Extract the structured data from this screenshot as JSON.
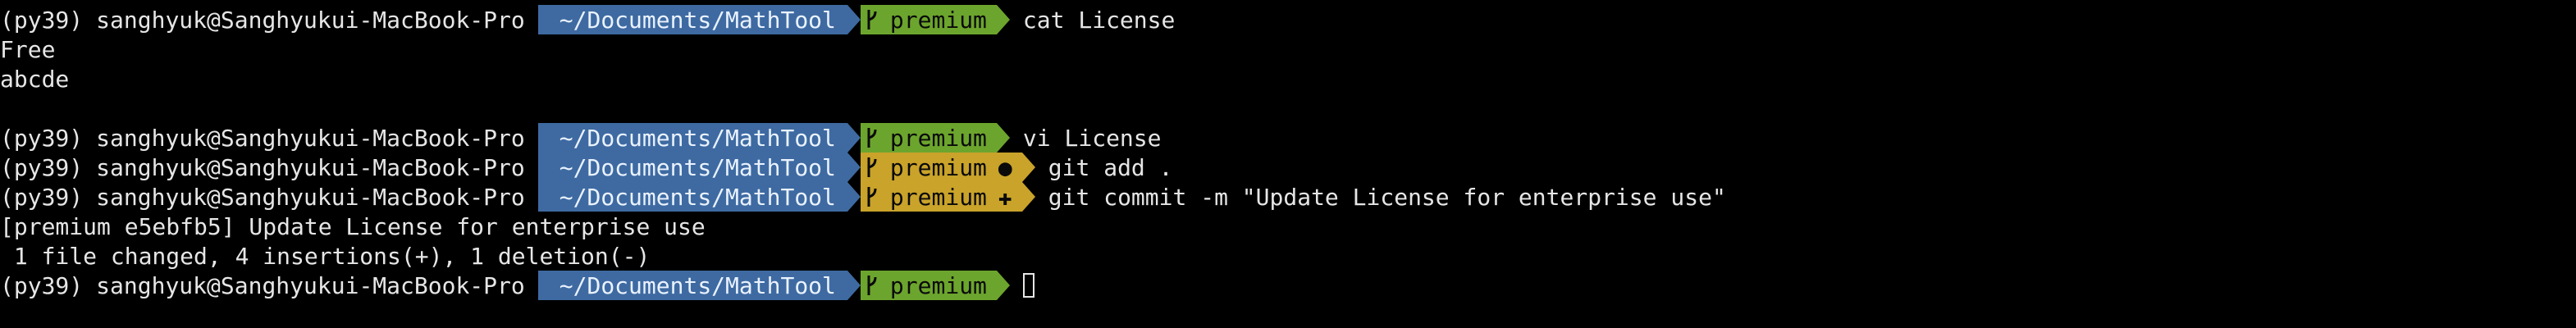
{
  "prompt": {
    "venv": "(py39)",
    "user_host": "sanghyuk@Sanghyukui-MacBook-Pro",
    "path": "~/Documents/MathTool",
    "branch": "premium"
  },
  "lines": [
    {
      "kind": "prompt",
      "status": "",
      "command": "cat License"
    },
    {
      "kind": "output",
      "text": "Free"
    },
    {
      "kind": "output",
      "text": "abcde"
    },
    {
      "kind": "blank",
      "text": ""
    },
    {
      "kind": "prompt",
      "status": "",
      "command": "vi License"
    },
    {
      "kind": "prompt",
      "status": "●",
      "command": "git add ."
    },
    {
      "kind": "prompt",
      "status": "✚",
      "command": "git commit -m \"Update License for enterprise use\""
    },
    {
      "kind": "output",
      "text": "[premium e5ebfb5] Update License for enterprise use"
    },
    {
      "kind": "output",
      "text": " 1 file changed, 4 insertions(+), 1 deletion(-)"
    },
    {
      "kind": "prompt",
      "status": "",
      "command": ""
    }
  ],
  "colors": {
    "background": "#000000",
    "dir_segment": "#3e6aa1",
    "git_clean": "#6ca52d",
    "git_dirty": "#c9a32a"
  },
  "icons": {
    "branch": "git-branch-icon",
    "segment_separator": "powerline-arrow"
  }
}
